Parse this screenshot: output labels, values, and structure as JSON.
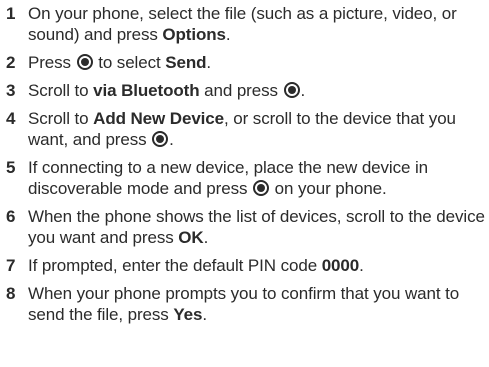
{
  "steps": [
    {
      "number": "1",
      "text_1": "On your phone, select the file (such as a picture, video, or sound) and press ",
      "bold_1": "Options",
      "text_2": "."
    },
    {
      "number": "2",
      "text_1": "Press ",
      "icon": "center-select-key-icon",
      "text_2": " to select ",
      "bold_1": "Send",
      "text_3": "."
    },
    {
      "number": "3",
      "text_1": "Scroll to ",
      "bold_1": "via Bluetooth",
      "text_2": " and press ",
      "icon": "center-select-key-icon",
      "text_3": "."
    },
    {
      "number": "4",
      "text_1": "Scroll to ",
      "bold_1": "Add New Device",
      "text_2": ", or scroll to the device that you want, and press ",
      "icon": "center-select-key-icon",
      "text_3": "."
    },
    {
      "number": "5",
      "text_1": "If connecting to a new device, place the new device in discoverable mode and press ",
      "icon": "center-select-key-icon",
      "text_2": " on your phone."
    },
    {
      "number": "6",
      "text_1": "When the phone shows the list of devices, scroll to the device you want and press ",
      "bold_1": "OK",
      "text_2": "."
    },
    {
      "number": "7",
      "text_1": "If prompted, enter the default PIN code ",
      "bold_1": "0000",
      "text_2": "."
    },
    {
      "number": "8",
      "text_1": "When your phone prompts you to confirm that you want to send the file, press ",
      "bold_1": "Yes",
      "text_2": "."
    }
  ]
}
